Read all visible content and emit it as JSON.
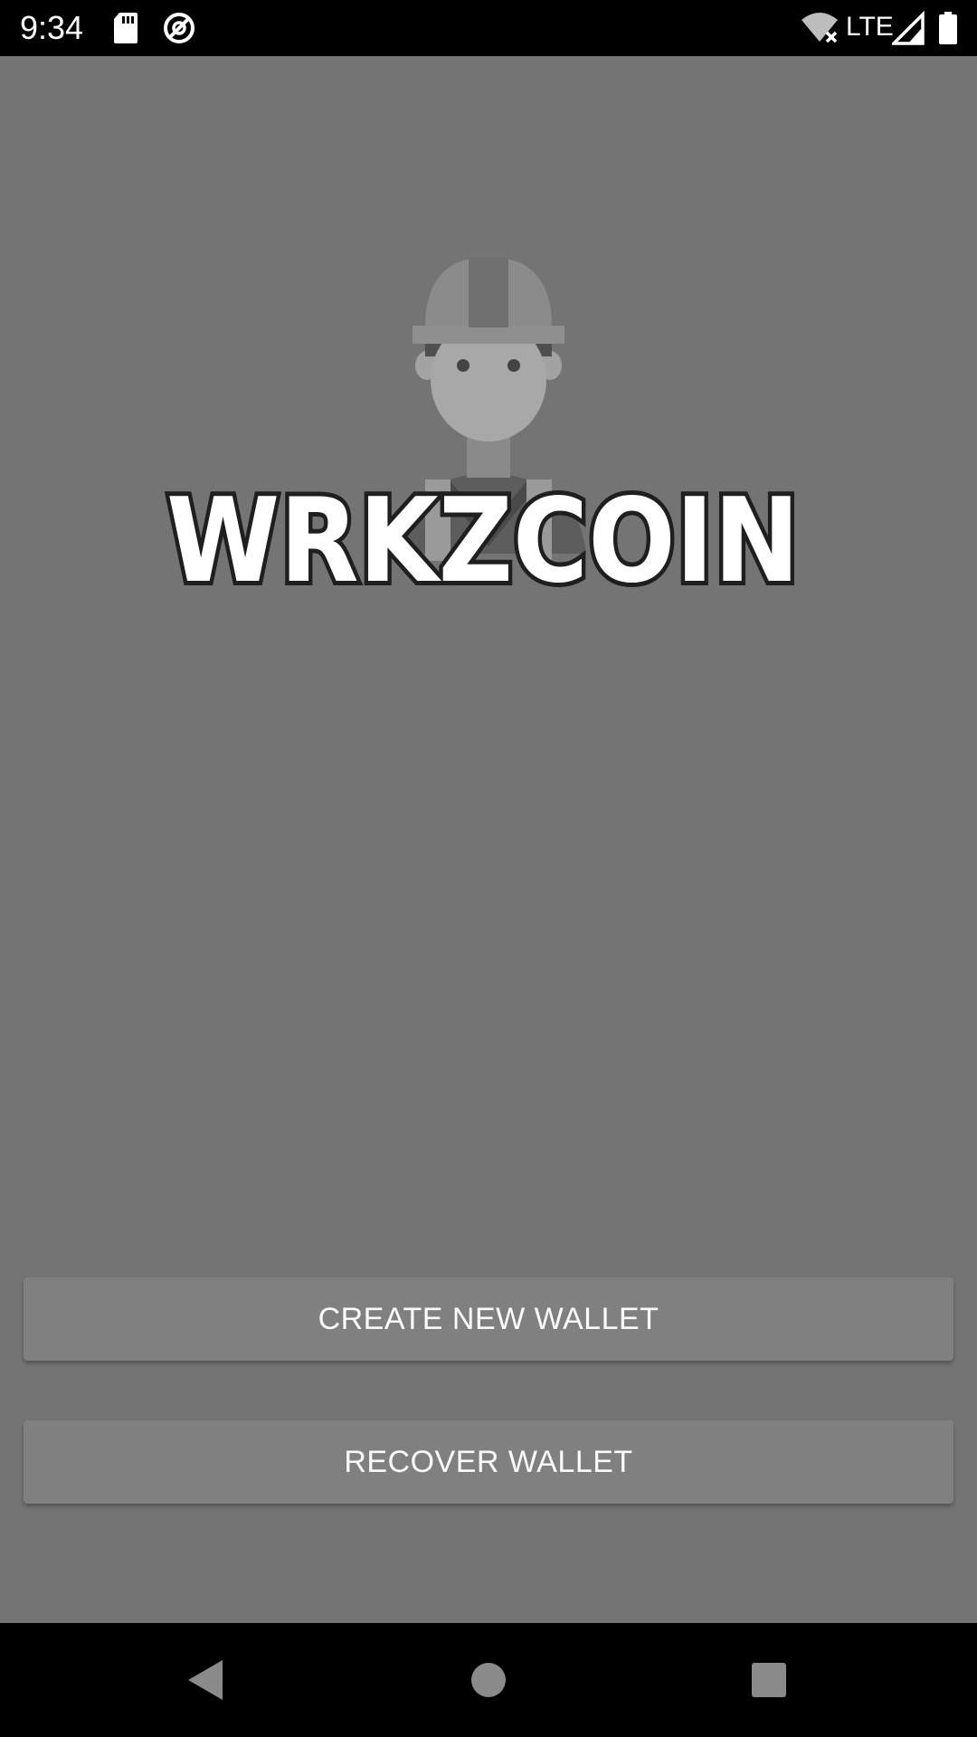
{
  "status_bar": {
    "time": "9:34",
    "icons": [
      "sd-card-icon",
      "sync-icon",
      "wifi-off-icon",
      "signal-icon",
      "battery-icon"
    ],
    "network_label": "LTE"
  },
  "logo": {
    "text": "WRKZCOIN",
    "icon": "worker-icon"
  },
  "buttons": {
    "create_label": "CREATE NEW WALLET",
    "recover_label": "RECOVER WALLET"
  },
  "nav_bar": {
    "icons": [
      "back-icon",
      "home-icon",
      "recents-icon"
    ]
  },
  "colors": {
    "background": "#747474",
    "button": "#808080",
    "bars": "#000000"
  }
}
